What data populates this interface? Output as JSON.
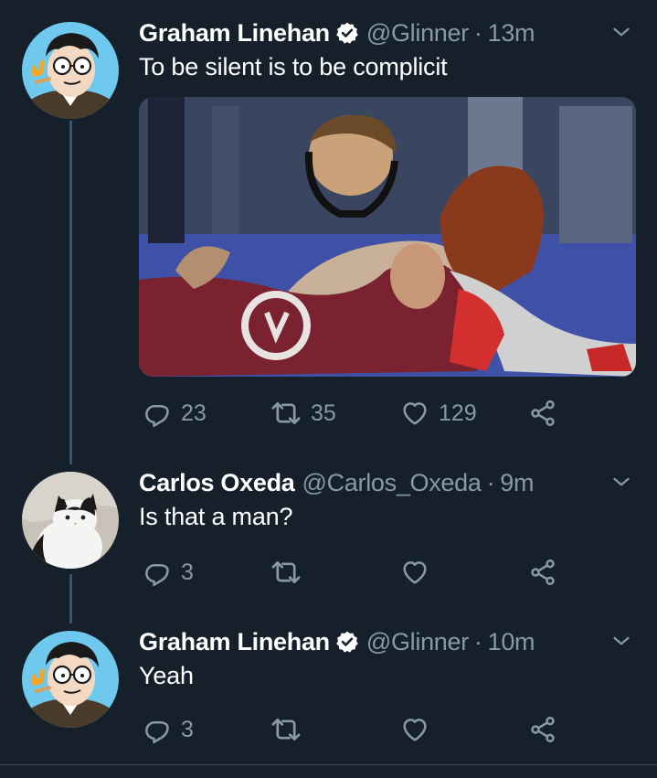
{
  "colors": {
    "background": "#15202b",
    "text_primary": "#ffffff",
    "text_secondary": "#8899a6",
    "thread_line": "#3d5466",
    "icon": "#8899a6"
  },
  "tweets": [
    {
      "author": {
        "name": "Graham Linehan",
        "handle": "@Glinner",
        "verified": true,
        "avatar": "cartoon-man-glasses-avatar"
      },
      "separator": "·",
      "time": "13m",
      "text": "To be silent is to be complicit",
      "media": {
        "description_icon": "wrestling-photo"
      },
      "actions": {
        "replies": "23",
        "retweets": "35",
        "likes": "129"
      }
    },
    {
      "author": {
        "name": "Carlos Oxeda",
        "handle": "@Carlos_Oxeda",
        "verified": false,
        "avatar": "cat-avatar"
      },
      "separator": "·",
      "time": "9m",
      "text": "Is that a man?",
      "actions": {
        "replies": "3",
        "retweets": "",
        "likes": ""
      }
    },
    {
      "author": {
        "name": "Graham Linehan",
        "handle": "@Glinner",
        "verified": true,
        "avatar": "cartoon-man-glasses-avatar"
      },
      "separator": "·",
      "time": "10m",
      "text": "Yeah",
      "actions": {
        "replies": "3",
        "retweets": "",
        "likes": ""
      }
    }
  ],
  "icons": {
    "reply": "reply-icon",
    "retweet": "retweet-icon",
    "like": "heart-icon",
    "share": "share-icon",
    "more": "chevron-down-icon",
    "verified": "verified-badge-icon"
  }
}
